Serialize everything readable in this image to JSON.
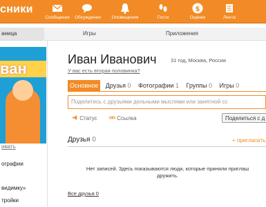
{
  "app": {
    "logo_text": "сники"
  },
  "nav": [
    {
      "label": "Сообщения",
      "icon": "envelope-icon"
    },
    {
      "label": "Обсуждения",
      "icon": "chat-icon"
    },
    {
      "label": "Оповещения",
      "icon": "bell-icon"
    },
    {
      "label": "Гости",
      "icon": "footprints-icon"
    },
    {
      "label": "Оценки",
      "icon": "rating-coin-icon"
    },
    {
      "label": "Лента",
      "icon": "feed-icon"
    }
  ],
  "subnav": {
    "side": "аница",
    "games": "Игры",
    "apps": "Приложения"
  },
  "avatar": {
    "banner": "ван"
  },
  "profile": {
    "name": "Иван Иванович",
    "meta": "31 год, Москва, Россия",
    "half_link": "У вас есть вторая половинка?"
  },
  "tabs": [
    {
      "label": "Основное",
      "count": ""
    },
    {
      "label": "Друзья",
      "count": "0"
    },
    {
      "label": "Фотографии",
      "count": "1"
    },
    {
      "label": "Группы",
      "count": "0"
    },
    {
      "label": "Игры",
      "count": "0"
    }
  ],
  "post": {
    "placeholder": "Поделитесь с друзьями дельными мыслями или занятной сс",
    "status": "Статус",
    "link": "Ссылка",
    "share": "Поделиться с д"
  },
  "friends": {
    "title": "Друзья",
    "count": "0",
    "add": "+ пригласить",
    "empty_line1": "Нет записей. Здесь показываются люди, которые приняли приглаш",
    "empty_line2": "дружить.",
    "all": "Все друзья",
    "all_count": "0"
  },
  "sidebar": {
    "edit": "ивать",
    "photos": "ографии",
    "invisible": "видимку»",
    "settings": "тройки"
  },
  "colors": {
    "accent": "#f28b25"
  }
}
